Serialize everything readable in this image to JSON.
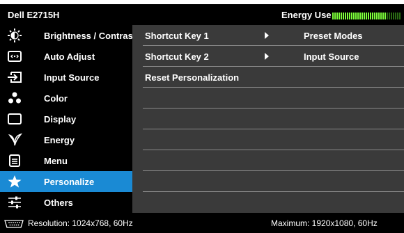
{
  "header": {
    "model": "Dell E2715H",
    "energy_label": "Energy Use",
    "energy_level": 0.78,
    "energy_color": "#7cff3a"
  },
  "sidebar": {
    "active_color": "#1a8ad4",
    "items": [
      {
        "label": "Brightness / Contrast",
        "icon": "brightness-icon"
      },
      {
        "label": "Auto Adjust",
        "icon": "auto-adjust-icon"
      },
      {
        "label": "Input Source",
        "icon": "input-source-icon"
      },
      {
        "label": "Color",
        "icon": "color-icon"
      },
      {
        "label": "Display",
        "icon": "display-icon"
      },
      {
        "label": "Energy",
        "icon": "energy-leaf-icon"
      },
      {
        "label": "Menu",
        "icon": "menu-icon"
      },
      {
        "label": "Personalize",
        "icon": "star-icon",
        "active": true
      },
      {
        "label": "Others",
        "icon": "sliders-icon"
      }
    ]
  },
  "panel": {
    "rows": [
      {
        "label": "Shortcut Key 1",
        "value": "Preset Modes"
      },
      {
        "label": "Shortcut Key 2",
        "value": "Input Source"
      },
      {
        "label": "Reset Personalization",
        "value": ""
      }
    ]
  },
  "footer": {
    "resolution": "Resolution: 1024x768,  60Hz",
    "maximum": "Maximum: 1920x1080,  60Hz"
  }
}
